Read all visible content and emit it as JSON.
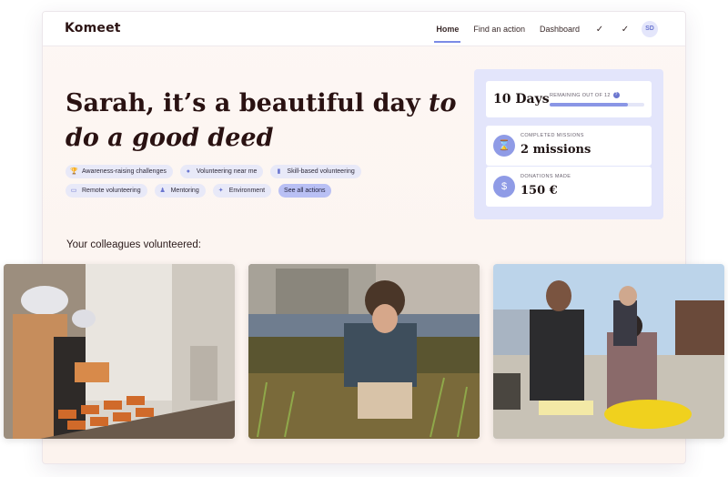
{
  "app": {
    "logo_text": "Komeet"
  },
  "nav": {
    "items": [
      {
        "label": "Home",
        "active": true
      },
      {
        "label": "Find an action",
        "active": false
      },
      {
        "label": "Dashboard",
        "active": false
      }
    ],
    "check_icons": [
      "✓",
      "✓"
    ],
    "avatar_initials": "SD"
  },
  "hero": {
    "name": "Sarah",
    "text_plain": ", it’s a beautiful day ",
    "text_italic": "to do a good deed"
  },
  "chips": [
    {
      "label": "Awareness-raising challenges",
      "icon": "trophy-icon",
      "glyph": "🏆"
    },
    {
      "label": "Volunteering near me",
      "icon": "location-pin-icon",
      "glyph": "●"
    },
    {
      "label": "Skill-based volunteering",
      "icon": "bookmark-icon",
      "glyph": "▮"
    },
    {
      "label": "Remote volunteering",
      "icon": "laptop-icon",
      "glyph": "▭"
    },
    {
      "label": "Mentoring",
      "icon": "people-icon",
      "glyph": "♟"
    },
    {
      "label": "Environment",
      "icon": "leaf-icon",
      "glyph": "✦"
    }
  ],
  "see_all_label": "See all actions",
  "stats": {
    "days_value": "10 Days",
    "days_caption": "REMAINING OUT OF 12",
    "days_remaining_fraction": 0.83,
    "info_glyph": "?",
    "missions_label": "COMPLETED MISSIONS",
    "missions_value": "2 missions",
    "missions_icon_glyph": "⌛",
    "donations_label": "DONATIONS MADE",
    "donations_value": "150 €",
    "donations_icon_glyph": "$"
  },
  "colleagues": {
    "title": "Your colleagues volunteered:"
  },
  "colors": {
    "accent": "#7b8be6",
    "card_bg": "#e3e5fb",
    "chip_bg": "#e8e9f8"
  }
}
